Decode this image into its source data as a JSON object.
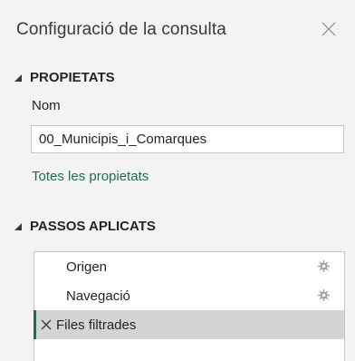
{
  "panel": {
    "title": "Configuració de la consulta",
    "close_icon": "close-icon"
  },
  "properties": {
    "header": "PROPIETATS",
    "name_label": "Nom",
    "name_value": "00_Municipis_i_Comarques",
    "all_properties_link": "Totes les propietats"
  },
  "applied_steps": {
    "header": "PASSOS APLICATS",
    "steps": [
      {
        "label": "Origen",
        "has_settings": true,
        "selected": false
      },
      {
        "label": "Navegació",
        "has_settings": true,
        "selected": false
      },
      {
        "label": "Files filtrades",
        "has_settings": false,
        "selected": true
      }
    ]
  },
  "colors": {
    "accent": "#1e6b5d",
    "background": "#f3f3f3",
    "selected_row": "#d4d4d4"
  }
}
